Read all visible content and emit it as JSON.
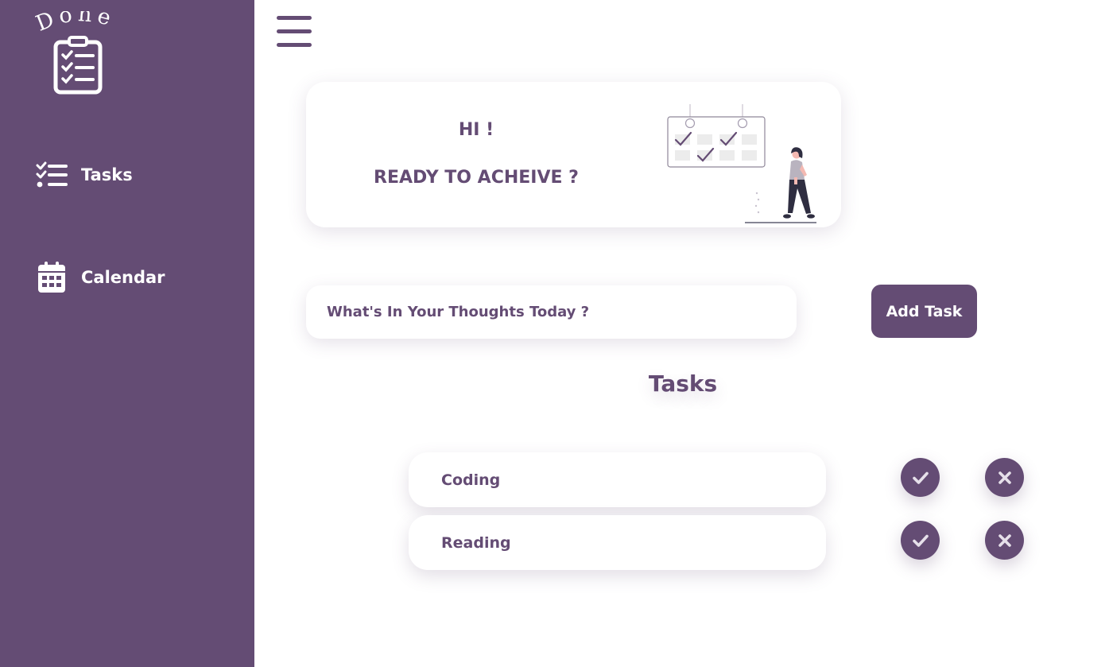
{
  "app": {
    "logo_text": "Done",
    "brand_color": "#644c74"
  },
  "sidebar": {
    "items": [
      {
        "label": "Tasks",
        "icon": "task-list-icon"
      },
      {
        "label": "Calendar",
        "icon": "calendar-icon"
      }
    ]
  },
  "header": {
    "menu_icon": "hamburger-menu-icon"
  },
  "hero": {
    "greeting": "HI !",
    "subtitle": "READY TO ACHEIVE ?",
    "illustration": "calendar-woman-illustration"
  },
  "composer": {
    "placeholder": "What's In Your Thoughts Today ?",
    "value": "",
    "add_label": "Add Task"
  },
  "tasks": {
    "heading": "Tasks",
    "items": [
      {
        "label": "Coding"
      },
      {
        "label": "Reading"
      }
    ],
    "complete_icon": "check-icon",
    "delete_icon": "close-icon"
  }
}
